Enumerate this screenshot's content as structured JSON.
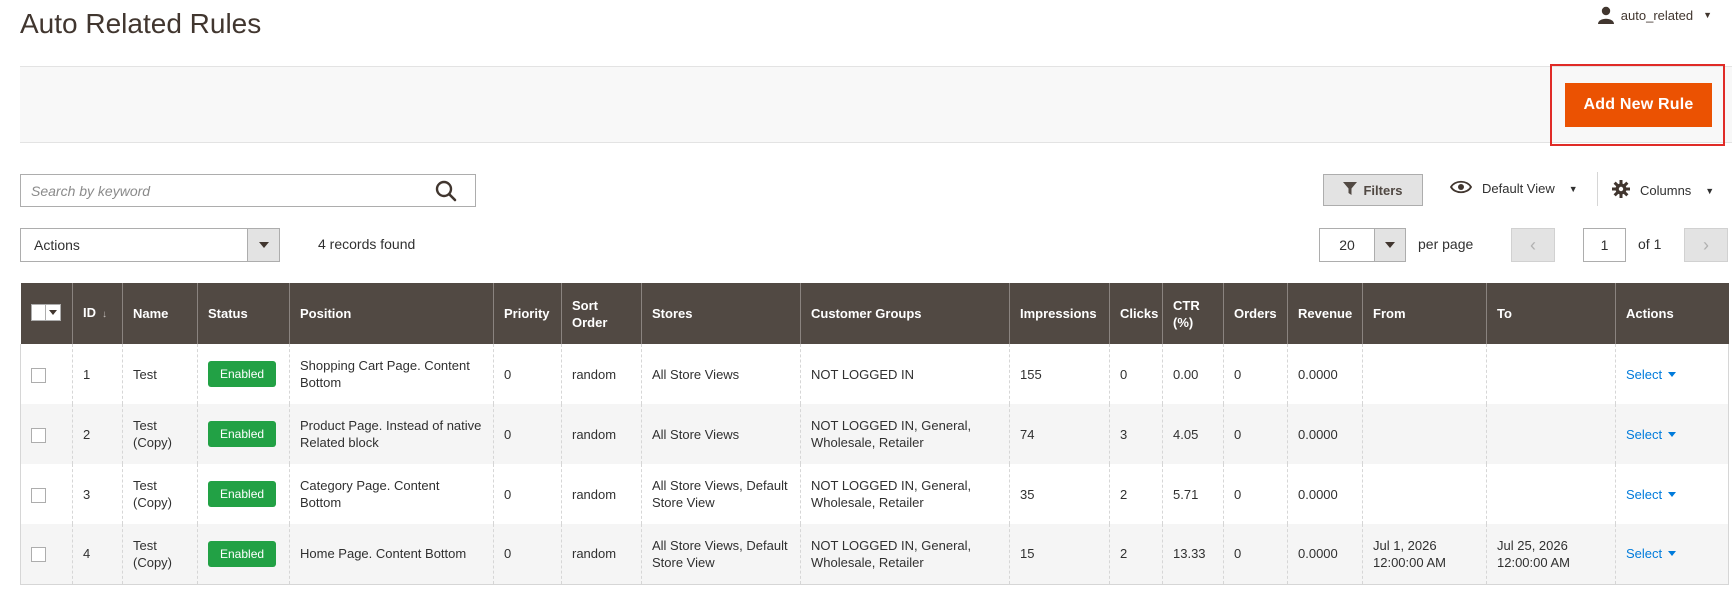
{
  "page": {
    "title": "Auto Related Rules"
  },
  "user": {
    "name": "auto_related"
  },
  "toolbar": {
    "add_label": "Add New Rule"
  },
  "search": {
    "placeholder": "Search by keyword"
  },
  "controls": {
    "filters_label": "Filters",
    "view_label": "Default View",
    "columns_label": "Columns",
    "mass_actions_label": "Actions",
    "records_found": "4 records found",
    "per_page_value": "20",
    "per_page_label": "per page",
    "current_page": "1",
    "page_total": "of 1"
  },
  "grid": {
    "columns": [
      "ID",
      "Name",
      "Status",
      "Position",
      "Priority",
      "Sort Order",
      "Stores",
      "Customer Groups",
      "Impressions",
      "Clicks",
      "CTR (%)",
      "Orders",
      "Revenue",
      "From",
      "To",
      "Actions"
    ],
    "rows": [
      {
        "id": "1",
        "name": "Test",
        "status": "Enabled",
        "position": "Shopping Cart Page. Content Bottom",
        "priority": "0",
        "sort_order": "random",
        "stores": "All Store Views",
        "customer_groups": "NOT LOGGED IN",
        "impressions": "155",
        "clicks": "0",
        "ctr": "0.00",
        "orders": "0",
        "revenue": "0.0000",
        "from": "",
        "to": "",
        "action": "Select"
      },
      {
        "id": "2",
        "name": "Test (Copy)",
        "status": "Enabled",
        "position": "Product Page. Instead of native Related block",
        "priority": "0",
        "sort_order": "random",
        "stores": "All Store Views",
        "customer_groups": "NOT LOGGED IN, General, Wholesale, Retailer",
        "impressions": "74",
        "clicks": "3",
        "ctr": "4.05",
        "orders": "0",
        "revenue": "0.0000",
        "from": "",
        "to": "",
        "action": "Select"
      },
      {
        "id": "3",
        "name": "Test (Copy)",
        "status": "Enabled",
        "position": "Category Page. Content Bottom",
        "priority": "0",
        "sort_order": "random",
        "stores": "All Store Views, Default Store View",
        "customer_groups": "NOT LOGGED IN, General, Wholesale, Retailer",
        "impressions": "35",
        "clicks": "2",
        "ctr": "5.71",
        "orders": "0",
        "revenue": "0.0000",
        "from": "",
        "to": "",
        "action": "Select"
      },
      {
        "id": "4",
        "name": "Test (Copy)",
        "status": "Enabled",
        "position": "Home Page. Content Bottom",
        "priority": "0",
        "sort_order": "random",
        "stores": "All Store Views, Default Store View",
        "customer_groups": "NOT LOGGED IN, General, Wholesale, Retailer",
        "impressions": "15",
        "clicks": "2",
        "ctr": "13.33",
        "orders": "0",
        "revenue": "0.0000",
        "from": "Jul 1, 2026 12:00:00 AM",
        "to": "Jul 25, 2026 12:00:00 AM",
        "action": "Select"
      }
    ]
  },
  "colors": {
    "accent": "#eb5202",
    "header_bg": "#514943",
    "status_enabled": "#22a145",
    "link": "#007bdb",
    "highlight_border": "#e02b27"
  },
  "icons": {
    "user": "user-icon",
    "search": "search-icon",
    "filter": "filter-icon",
    "view": "eye-icon",
    "columns": "gear-icon"
  }
}
